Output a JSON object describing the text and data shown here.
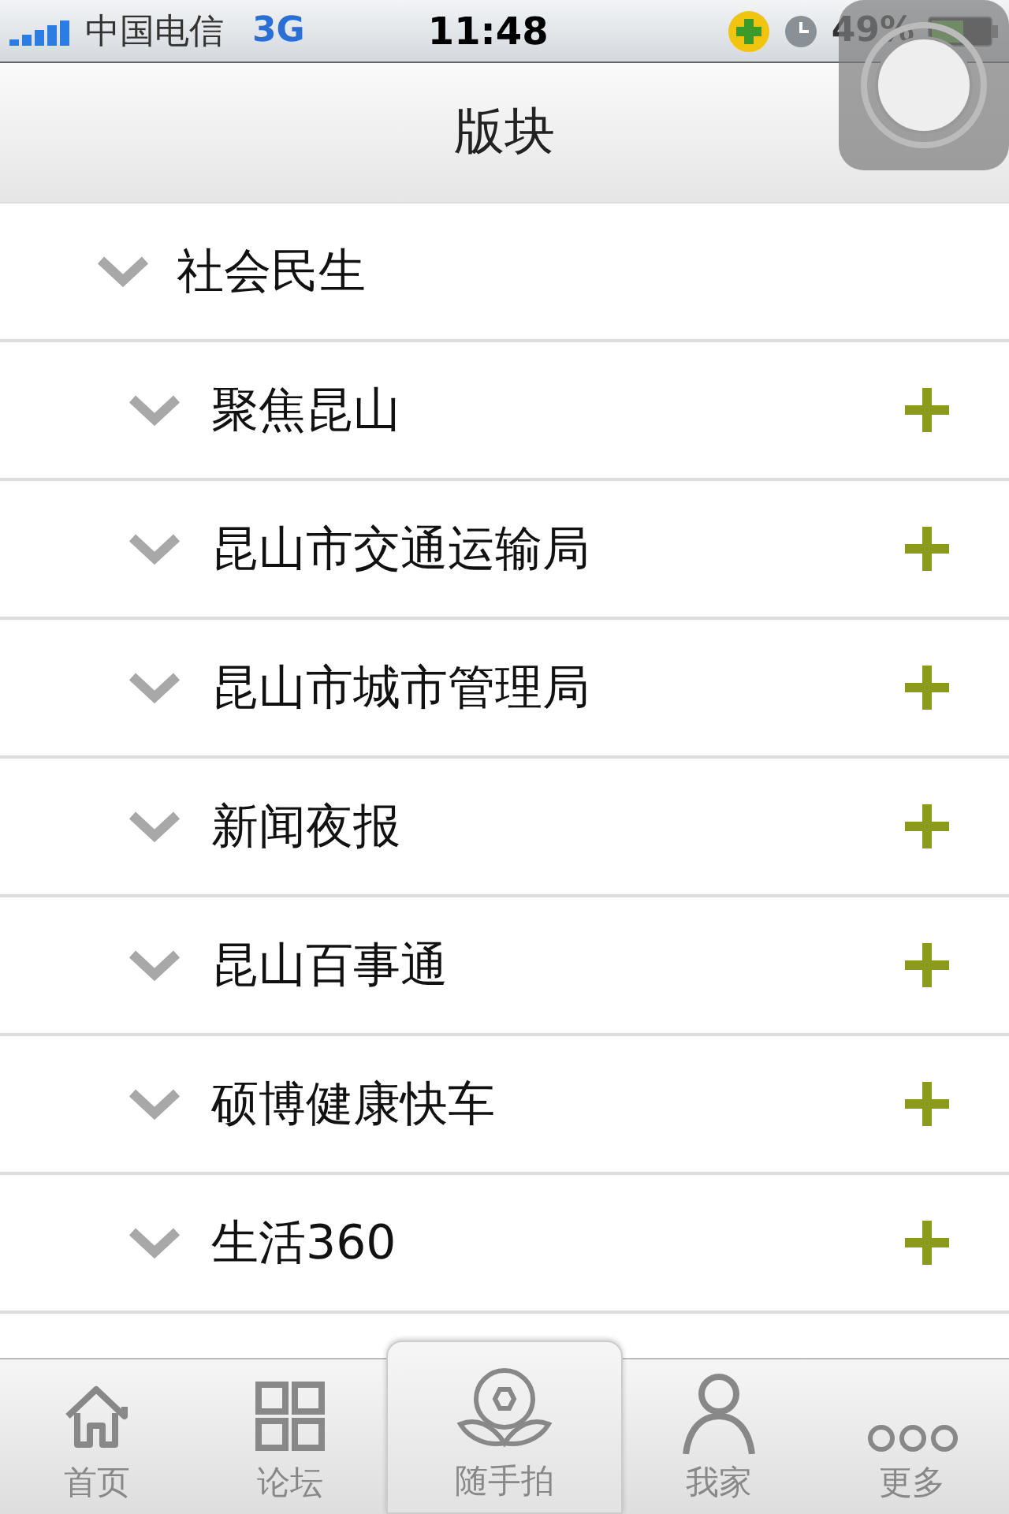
{
  "status_bar": {
    "carrier": "中国电信",
    "network": "3G",
    "time": "11:48",
    "battery": "49%"
  },
  "header": {
    "title": "版块"
  },
  "section": {
    "label": "社会民生",
    "expanded": true,
    "children": [
      {
        "label": "聚焦昆山",
        "expanded": true
      },
      {
        "label": "昆山市交通运输局",
        "expanded": true
      },
      {
        "label": "昆山市城市管理局",
        "expanded": true
      },
      {
        "label": "新闻夜报",
        "expanded": true
      },
      {
        "label": "昆山百事通",
        "expanded": true
      },
      {
        "label": "硕博健康快车",
        "expanded": true
      },
      {
        "label": "生活360",
        "expanded": true
      }
    ]
  },
  "tab_bar": [
    {
      "label": "首页",
      "kind": "home"
    },
    {
      "label": "论坛",
      "kind": "grid"
    },
    {
      "label": "随手拍",
      "kind": "camera"
    },
    {
      "label": "我家",
      "kind": "person"
    },
    {
      "label": "更多",
      "kind": "more"
    }
  ]
}
